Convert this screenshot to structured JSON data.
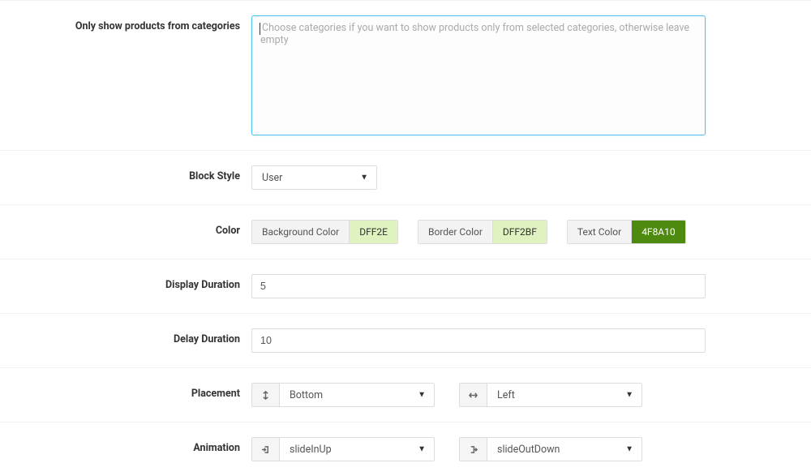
{
  "categories": {
    "label": "Only show products from categories",
    "placeholder": "Choose categories if you want to show products only from selected categories, otherwise leave empty"
  },
  "blockStyle": {
    "label": "Block Style",
    "value": "User"
  },
  "color": {
    "label": "Color",
    "bgLabel": "Background Color",
    "bgValue": "DFF2E",
    "borderLabel": "Border Color",
    "borderValue": "DFF2BF",
    "textLabel": "Text Color",
    "textValue": "4F8A10"
  },
  "displayDuration": {
    "label": "Display Duration",
    "value": "5"
  },
  "delayDuration": {
    "label": "Delay Duration",
    "value": "10"
  },
  "placement": {
    "label": "Placement",
    "verticalValue": "Bottom",
    "horizontalValue": "Left"
  },
  "animation": {
    "label": "Animation",
    "inValue": "slideInUp",
    "outValue": "slideOutDown"
  }
}
